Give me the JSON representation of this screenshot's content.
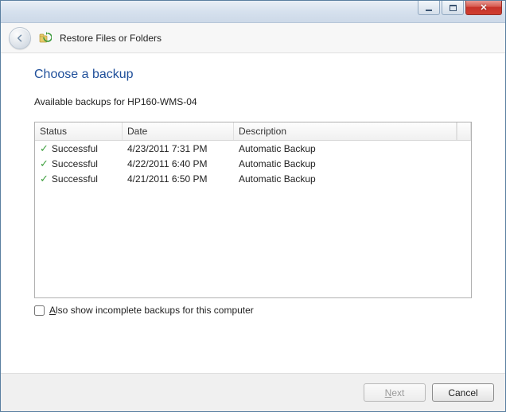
{
  "header": {
    "title": "Restore Files or Folders"
  },
  "page": {
    "heading": "Choose a backup",
    "subtitle": "Available backups for HP160-WMS-04"
  },
  "columns": {
    "status": "Status",
    "date": "Date",
    "description": "Description"
  },
  "backups": [
    {
      "status": "Successful",
      "date": "4/23/2011 7:31 PM",
      "description": "Automatic Backup"
    },
    {
      "status": "Successful",
      "date": "4/22/2011 6:40 PM",
      "description": "Automatic Backup"
    },
    {
      "status": "Successful",
      "date": "4/21/2011 6:50 PM",
      "description": "Automatic Backup"
    }
  ],
  "checkbox": {
    "prefix": "A",
    "rest": "lso show incomplete backups for this computer"
  },
  "buttons": {
    "next_prefix": "N",
    "next_rest": "ext",
    "cancel": "Cancel"
  }
}
